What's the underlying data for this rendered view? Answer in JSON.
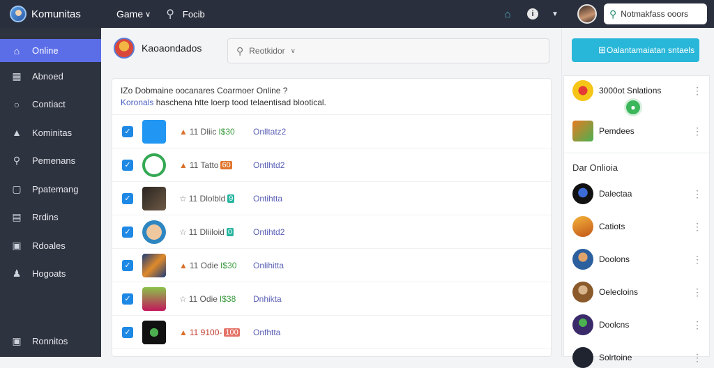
{
  "app": {
    "title": "Komunitas",
    "games_label": "Game",
    "search_label": "Focib",
    "top_search_placeholder": "Notmakfass ooors"
  },
  "sidebar": {
    "items": [
      {
        "label": "Online",
        "icon": "home-icon",
        "active": true
      },
      {
        "label": "Abnoed",
        "icon": "building-icon"
      },
      {
        "label": "Contiact",
        "icon": "chat-icon"
      },
      {
        "label": "Kominitas",
        "icon": "triangle-icon"
      },
      {
        "label": "Pemenans",
        "icon": "search-icon"
      },
      {
        "label": "Ppatemang",
        "icon": "document-icon"
      },
      {
        "label": "Rrdins",
        "icon": "book-icon"
      },
      {
        "label": "Rdoales",
        "icon": "folder-icon"
      },
      {
        "label": "Hogoats",
        "icon": "people-icon"
      }
    ],
    "bottom": {
      "label": "Ronnitos",
      "icon": "users-icon"
    }
  },
  "main": {
    "title": "Kaoaondados",
    "search_placeholder": "Reotkidor",
    "question": "IZo Dobmaine oocanares Coarmoer Online ?",
    "sub_link": "Koronals",
    "sub_text": "haschena htte loerp tood telaentisad blootical.",
    "rows": [
      {
        "stat_prefix": "11 Dliic",
        "stat_value": "I$30",
        "badge": "",
        "status": "Onlltatz2",
        "thumb_color": "#2196f3"
      },
      {
        "stat_prefix": "11 Tatto",
        "stat_value": "",
        "badge": "60",
        "status": "Ontlhtd2",
        "thumb_color": "#34a853"
      },
      {
        "stat_prefix": "11 Dlolbld",
        "stat_value": "",
        "badge": "9",
        "status": "Ontihtta",
        "thumb_color": "#4a3b2f"
      },
      {
        "stat_prefix": "11 Dliiloid",
        "stat_value": "",
        "badge": "0",
        "status": "Ontihtd2",
        "thumb_color": "#2e86c1"
      },
      {
        "stat_prefix": "11 Odie",
        "stat_value": "I$30",
        "badge": "",
        "status": "Onlihitta",
        "thumb_color": "#d97b29"
      },
      {
        "stat_prefix": "11 Odie",
        "stat_value": "I$38",
        "badge": "",
        "status": "Dnhikta",
        "thumb_color": "#8bc34a"
      },
      {
        "stat_prefix": "11 9100-",
        "stat_value": "",
        "badge": "100",
        "status": "Onfhtta",
        "thumb_color": "#1b1b1b"
      }
    ]
  },
  "right": {
    "button_label": "Oalantamaiatan sntaels",
    "top_friends": [
      {
        "name": "3000ot Snlations",
        "color": "#f5c518"
      },
      {
        "name": "Pemdees",
        "color": "#e57c23"
      }
    ],
    "section_title": "Dar Onlioia",
    "friends": [
      {
        "name": "Dalectaa",
        "color": "#1a2a4a"
      },
      {
        "name": "Catiots",
        "color": "#e08a1e"
      },
      {
        "name": "Doolons",
        "color": "#2c5f9e"
      },
      {
        "name": "Oelecloins",
        "color": "#8a5a2b"
      },
      {
        "name": "Doolcns",
        "color": "#3a2a6a"
      },
      {
        "name": "Solrtoine",
        "color": "#1f2430"
      }
    ]
  }
}
